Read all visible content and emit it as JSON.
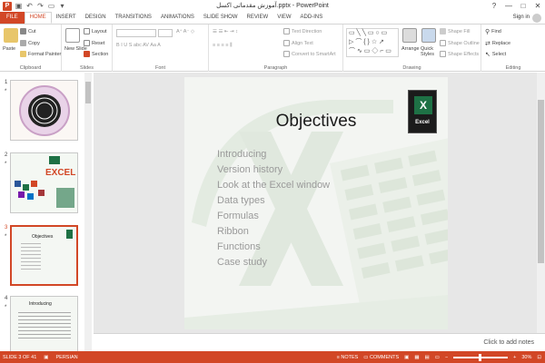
{
  "window": {
    "title": "آموزش مقدماتی اکسل.pptx - PowerPoint",
    "app_letter": "P",
    "controls": [
      "?",
      "—",
      "□",
      "✕"
    ]
  },
  "tabs": [
    "FILE",
    "HOME",
    "INSERT",
    "DESIGN",
    "TRANSITIONS",
    "ANIMATIONS",
    "SLIDE SHOW",
    "REVIEW",
    "VIEW",
    "ADD-INS"
  ],
  "active_tab": "HOME",
  "signin": "Sign in",
  "ribbon": {
    "clipboard": {
      "paste": "Paste",
      "cut": "Cut",
      "copy": "Copy",
      "format_painter": "Format Painter",
      "label": "Clipboard"
    },
    "slides": {
      "new_slide": "New Slide",
      "layout": "Layout",
      "reset": "Reset",
      "section": "Section",
      "label": "Slides"
    },
    "font": {
      "label": "Font"
    },
    "paragraph": {
      "text_direction": "Text Direction",
      "align_text": "Align Text",
      "convert_smartart": "Convert to SmartArt",
      "label": "Paragraph"
    },
    "drawing": {
      "arrange": "Arrange",
      "quick_styles": "Quick Styles",
      "shape_fill": "Shape Fill",
      "shape_outline": "Shape Outline",
      "shape_effects": "Shape Effects",
      "label": "Drawing"
    },
    "editing": {
      "find": "Find",
      "replace": "Replace",
      "select": "Select",
      "label": "Editing"
    }
  },
  "thumbnails": [
    {
      "number": "1",
      "star": "*"
    },
    {
      "number": "2",
      "star": "*",
      "text": "EXCEL"
    },
    {
      "number": "3",
      "star": "*",
      "text": "Objectives"
    },
    {
      "number": "4",
      "star": "*",
      "text": "Introducing"
    }
  ],
  "slide": {
    "title": "Objectives",
    "bullets": [
      "Introducing",
      "Version history",
      "Look at the Excel window",
      "Data types",
      "Formulas",
      "Ribbon",
      "Functions",
      "Case study"
    ],
    "logo_text": "Excel",
    "logo_letter": "X"
  },
  "notes_placeholder": "Click to add notes",
  "status": {
    "slide_info": "SLIDE 3 OF 41",
    "language": "PERSIAN",
    "notes": "NOTES",
    "comments": "COMMENTS",
    "zoom": "30%"
  },
  "colors": {
    "accent": "#d24726",
    "excel_green": "#1e7145"
  }
}
